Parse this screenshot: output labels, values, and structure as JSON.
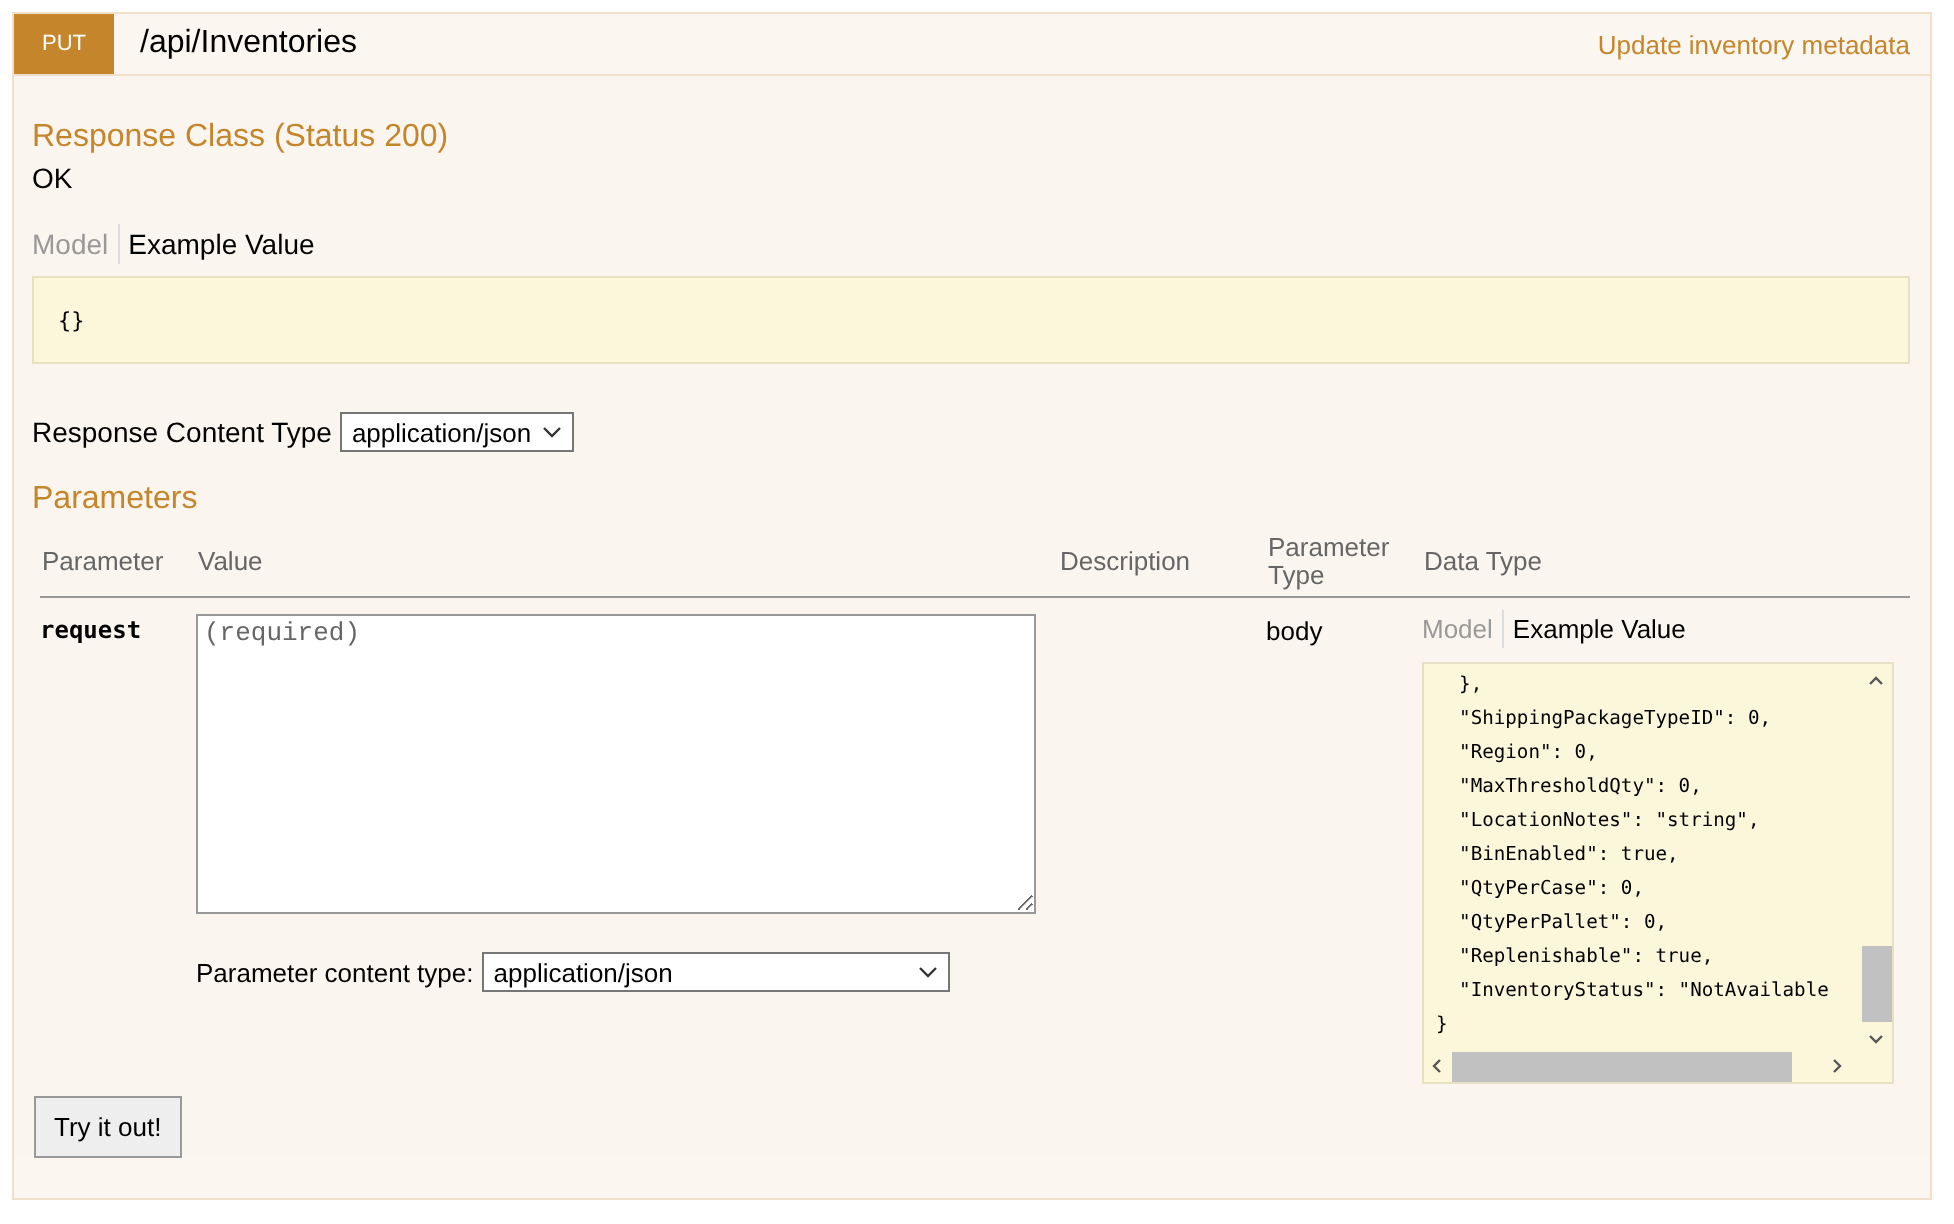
{
  "operation": {
    "method": "PUT",
    "path": "/api/Inventories",
    "summary": "Update inventory metadata"
  },
  "response_class": {
    "title": "Response Class (Status 200)",
    "status_text": "OK",
    "tabs": [
      {
        "label": "Model",
        "selected": false
      },
      {
        "label": "Example Value",
        "selected": true
      }
    ],
    "example": "{}"
  },
  "response_content_type": {
    "label": "Response Content Type",
    "value": "application/json"
  },
  "parameters": {
    "title": "Parameters",
    "columns": [
      "Parameter",
      "Value",
      "Description",
      "Parameter Type",
      "Data Type"
    ],
    "rows": [
      {
        "name": "request",
        "placeholder": "(required)",
        "content_type_label": "Parameter content type:",
        "content_type": "application/json",
        "param_type": "body",
        "tabs": [
          {
            "label": "Model",
            "selected": false
          },
          {
            "label": "Example Value",
            "selected": true
          }
        ],
        "example_lines": [
          "  },",
          "  \"ShippingPackageTypeID\": 0,",
          "  \"Region\": 0,",
          "  \"MaxThresholdQty\": 0,",
          "  \"LocationNotes\": \"string\",",
          "  \"BinEnabled\": true,",
          "  \"QtyPerCase\": 0,",
          "  \"QtyPerPallet\": 0,",
          "  \"Replenishable\": true,",
          "  \"InventoryStatus\": \"NotAvailable",
          "}"
        ]
      }
    ]
  },
  "submit": {
    "label": "Try it out!"
  }
}
